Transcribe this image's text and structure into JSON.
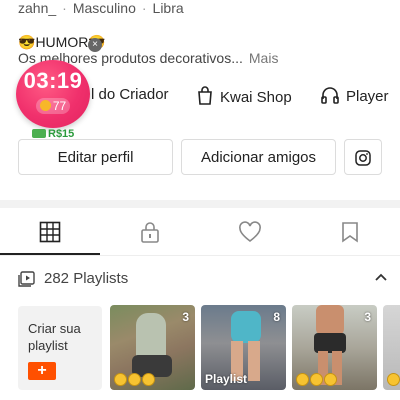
{
  "profile": {
    "handle": "zahn_",
    "gender": "Masculino",
    "sign": "Libra",
    "separator": "·",
    "bio_line": "HUMOR",
    "description": "Os melhores produtos decorativos...",
    "more_label": "Mais"
  },
  "timer": {
    "time": "03:19",
    "coins": "77",
    "cash": "R$15"
  },
  "links": {
    "creator": "l do Criador",
    "shop": "Kwai Shop",
    "player": "Player"
  },
  "actions": {
    "edit_profile": "Editar perfil",
    "add_friends": "Adicionar amigos"
  },
  "playlists": {
    "count_label": "282 Playlists",
    "create_label": "Criar sua playlist",
    "plus": "+",
    "items": [
      {
        "count": "3",
        "caption": ""
      },
      {
        "count": "8",
        "caption": "Playlist"
      },
      {
        "count": "3",
        "caption": ""
      }
    ]
  },
  "colors": {
    "accent": "#ff5000",
    "timer": "#f0306c",
    "cash": "#2c9b3d"
  }
}
